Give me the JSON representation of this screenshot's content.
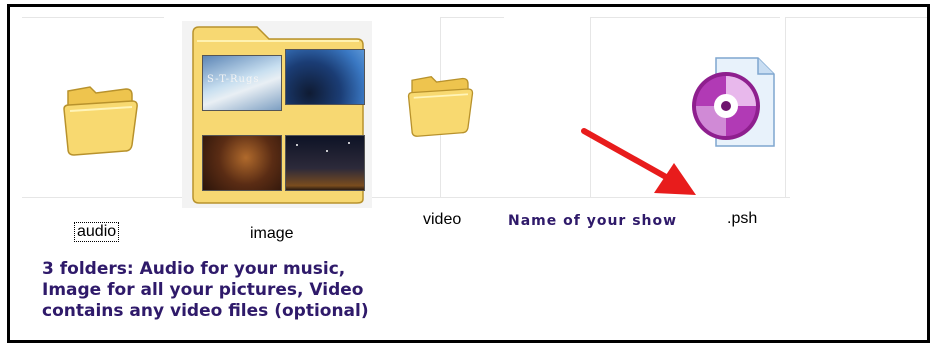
{
  "items": [
    {
      "label": "audio",
      "icon": "folder-icon",
      "selected": true
    },
    {
      "label": "image",
      "icon": "folder-with-thumbnails-icon"
    },
    {
      "label": "video",
      "icon": "folder-icon"
    },
    {
      "label": ".psh",
      "icon": "photoshow-file-icon"
    }
  ],
  "annotation": {
    "show_name": "Name of your show",
    "description_lines": [
      "3 folders: Audio for your music,",
      "Image for all your pictures, Video",
      "contains any video files (optional)"
    ],
    "color": "#2f1a6a"
  },
  "thumbnail_caption": "S-T-Rugs",
  "colors": {
    "folder": "#f6d466",
    "arrow": "#e81c1c",
    "border": "#000000"
  }
}
